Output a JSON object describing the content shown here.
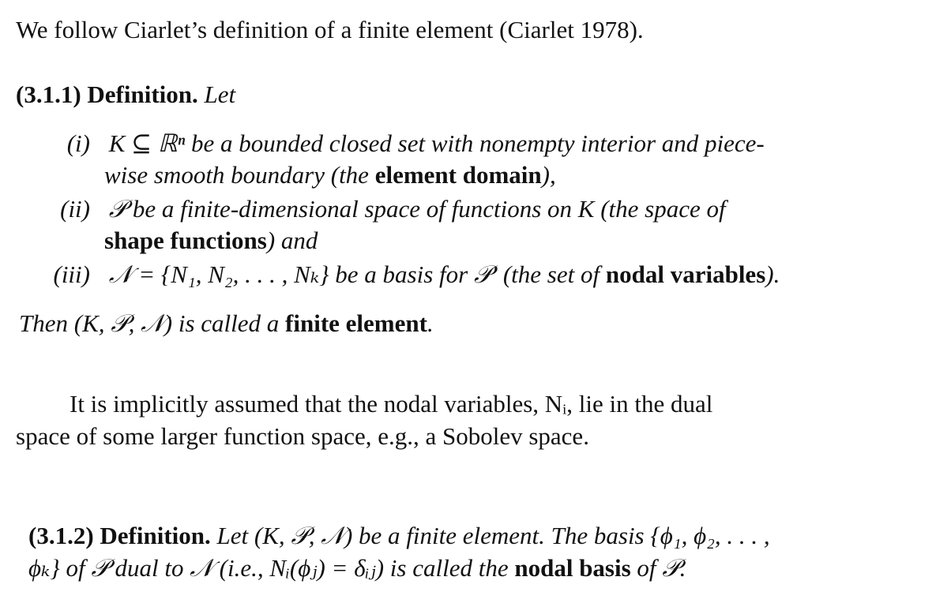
{
  "intro": "We follow Ciarlet’s definition of a finite element (Ciarlet 1978).",
  "def1": {
    "number": "(3.1.1)",
    "title": "Definition.",
    "lead": "Let",
    "items": [
      {
        "label": "(i)",
        "line1": "K ⊆ ℝⁿ be a bounded closed set with nonempty interior and piece-",
        "line2_pre": "wise smooth boundary (the ",
        "line2_term": "element domain",
        "line2_post": "),"
      },
      {
        "label": "(ii)",
        "line1": "𝒫 be a finite-dimensional space of functions on K (the space of",
        "line2_term": "shape functions",
        "line2_post": ") and"
      },
      {
        "label": "(iii)",
        "line1_pre": "𝒩 = {N₁, N₂, . . . , Nₖ} be a basis for 𝒫′ (the set of ",
        "line1_term": "nodal variables",
        "line1_post": ")."
      }
    ],
    "then_pre": "Then (K, 𝒫, 𝒩) is called a ",
    "then_term": "finite element",
    "then_post": "."
  },
  "remark": {
    "line1": "It is implicitly assumed that the nodal variables, Nᵢ, lie in the dual",
    "line2": "space of some larger function space, e.g., a Sobolev space."
  },
  "def2": {
    "number": "(3.1.2)",
    "title": "Definition.",
    "line1": "Let (K, 𝒫, 𝒩) be a finite element. The basis {ϕ₁, ϕ₂, . . . ,",
    "line2_pre": "ϕₖ} of 𝒫 dual to 𝒩 (i.e., Nᵢ(ϕⱼ) = δᵢⱼ) is called the ",
    "line2_term": "nodal basis",
    "line2_post": " of 𝒫."
  }
}
